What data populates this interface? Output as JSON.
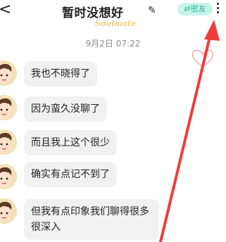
{
  "header": {
    "back_label": "<",
    "title": "暂时没想好",
    "edit_icon": "✎",
    "friend_button": "⇄密友",
    "watermark": "Soulmate"
  },
  "timestamp": "9月2日 07:22",
  "messages": [
    {
      "text": "我也不晓得了"
    },
    {
      "text": "因为蛮久没聊了"
    },
    {
      "text": "而且我上这个很少"
    },
    {
      "text": "确实有点记不到了"
    },
    {
      "text": "但我有点印象我们聊得很多很深入"
    }
  ],
  "colors": {
    "bubble": "#f1f1f1",
    "accent": "#1db896",
    "arrow": "#f03c3c",
    "heart": "#f7a6a6"
  }
}
